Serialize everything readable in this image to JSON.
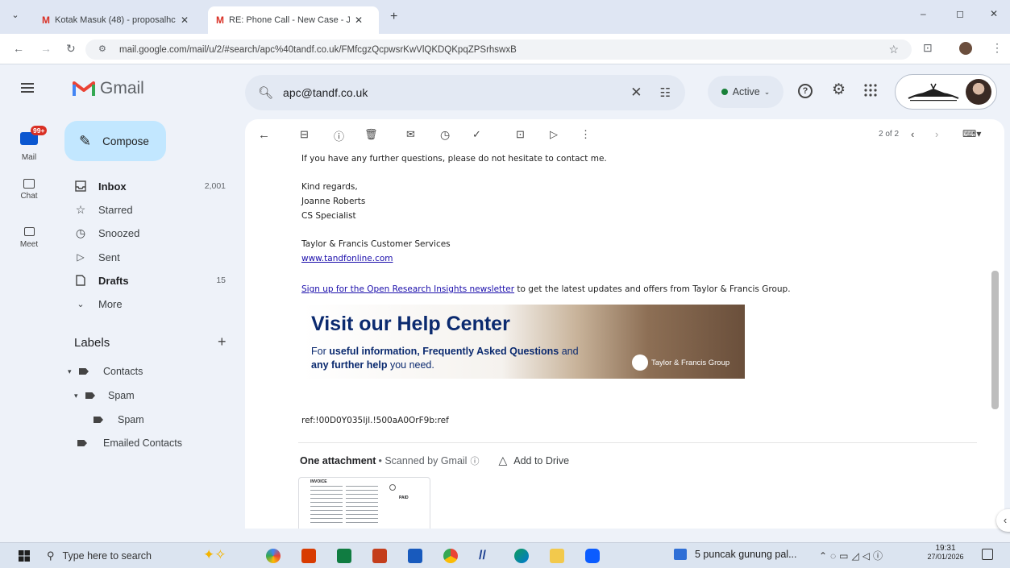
{
  "browser": {
    "tabs": [
      {
        "title": "Kotak Masuk (48) - proposalhc",
        "active": false
      },
      {
        "title": "RE: Phone Call - New Case - Jo",
        "active": true
      }
    ],
    "new_tab": "+",
    "url": "mail.google.com/mail/u/2/#search/apc%40tandf.co.uk/FMfcgzQcpwsrKwVlQKDQKpqZPSrhswxB",
    "win": {
      "min": "‒",
      "max": "◻",
      "close": "✕"
    }
  },
  "gmail": {
    "product": "Gmail",
    "search_query": "apc@tandf.co.uk",
    "status": "Active",
    "rail": [
      {
        "label": "Mail",
        "badge": "99+"
      },
      {
        "label": "Chat"
      },
      {
        "label": "Meet"
      }
    ],
    "compose": "Compose",
    "nav": [
      {
        "label": "Inbox",
        "count": "2,001"
      },
      {
        "label": "Starred",
        "count": ""
      },
      {
        "label": "Snoozed",
        "count": ""
      },
      {
        "label": "Sent",
        "count": ""
      },
      {
        "label": "Drafts",
        "count": "15"
      },
      {
        "label": "More",
        "count": ""
      }
    ],
    "labels_heading": "Labels",
    "labels": [
      {
        "label": "Contacts"
      },
      {
        "label": "Spam"
      },
      {
        "label": "Spam"
      },
      {
        "label": "Emailed Contacts"
      }
    ],
    "pager": "2 of 2"
  },
  "email": {
    "line1": "If you have any further questions, please do not hesitate to contact me.",
    "regards": "Kind regards,",
    "name": "Joanne Roberts",
    "role": "CS Specialist",
    "company": "Taylor & Francis Customer Services",
    "website": "www.tandfonline.com",
    "signup_link": "Sign up for the Open Research Insights newsletter",
    "signup_rest": " to get the latest updates and offers from Taylor & Francis Group.",
    "banner": {
      "title": "Visit our Help Center",
      "line1_pre": "For ",
      "line1_bold": "useful information, Frequently Asked Questions",
      "line1_post": " and",
      "line2_bold": "any further help",
      "line2_post": " you need.",
      "brand": "Taylor & Francis Group"
    },
    "ref": "ref:!00D0Y035Ijl.!500aA0OrF9b:ref",
    "attachment_title": "One attachment",
    "attachment_scan": " • Scanned by Gmail",
    "add_to_drive": "Add to Drive",
    "thumb": {
      "heading": "INVOICE",
      "paid": "PAID"
    }
  },
  "taskbar": {
    "search_placeholder": "Type here to search",
    "media_title": "5 puncak gunung pal...",
    "time": "19:31",
    "date": "27/01/2026"
  },
  "colors": {
    "accent": "#c2e7ff",
    "active_dot": "#188038",
    "badge": "#d93025",
    "link": "#1a0dab"
  }
}
